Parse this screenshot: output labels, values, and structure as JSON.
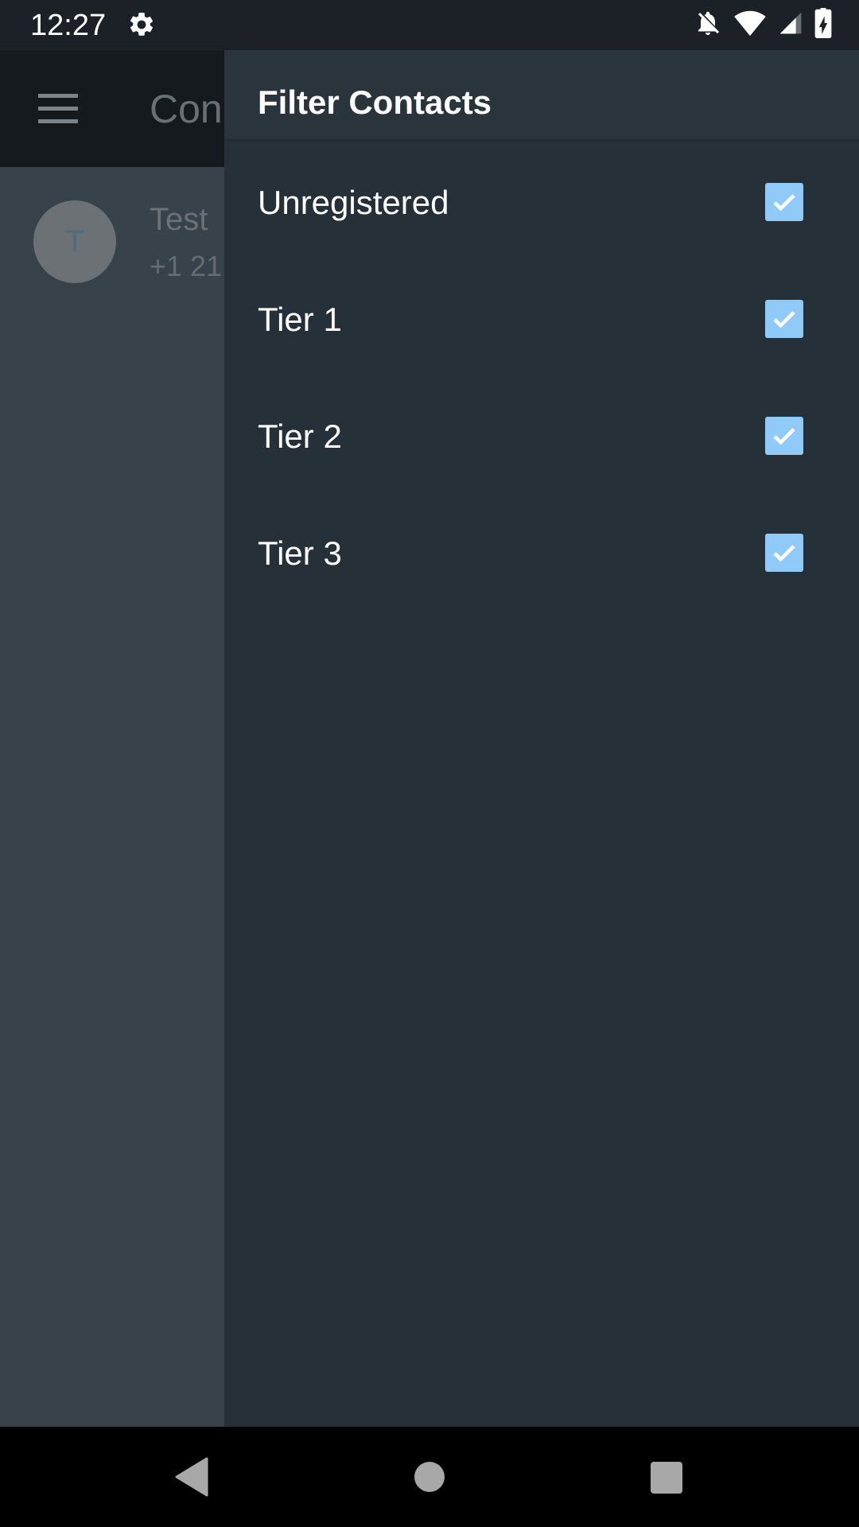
{
  "status_bar": {
    "time": "12:27",
    "icons": [
      "gear-icon",
      "notifications-off-icon",
      "wifi-icon",
      "cell-signal-icon",
      "battery-charging-icon"
    ]
  },
  "app_bar": {
    "menu_icon": "hamburger-menu-icon",
    "title": "Con"
  },
  "contacts": [
    {
      "avatar_letter": "T",
      "name": "Test",
      "phone": "+1 21"
    }
  ],
  "drawer": {
    "title": "Filter Contacts",
    "filters": [
      {
        "label": "Unregistered",
        "checked": true
      },
      {
        "label": "Tier 1",
        "checked": true
      },
      {
        "label": "Tier 2",
        "checked": true
      },
      {
        "label": "Tier 3",
        "checked": true
      }
    ]
  },
  "nav_bar": {
    "icons": [
      "back-icon",
      "home-icon",
      "recents-icon"
    ]
  },
  "colors": {
    "drawer_background": "#263038",
    "checkbox_accent": "#90caf9",
    "scrim_background": "#37424a"
  }
}
